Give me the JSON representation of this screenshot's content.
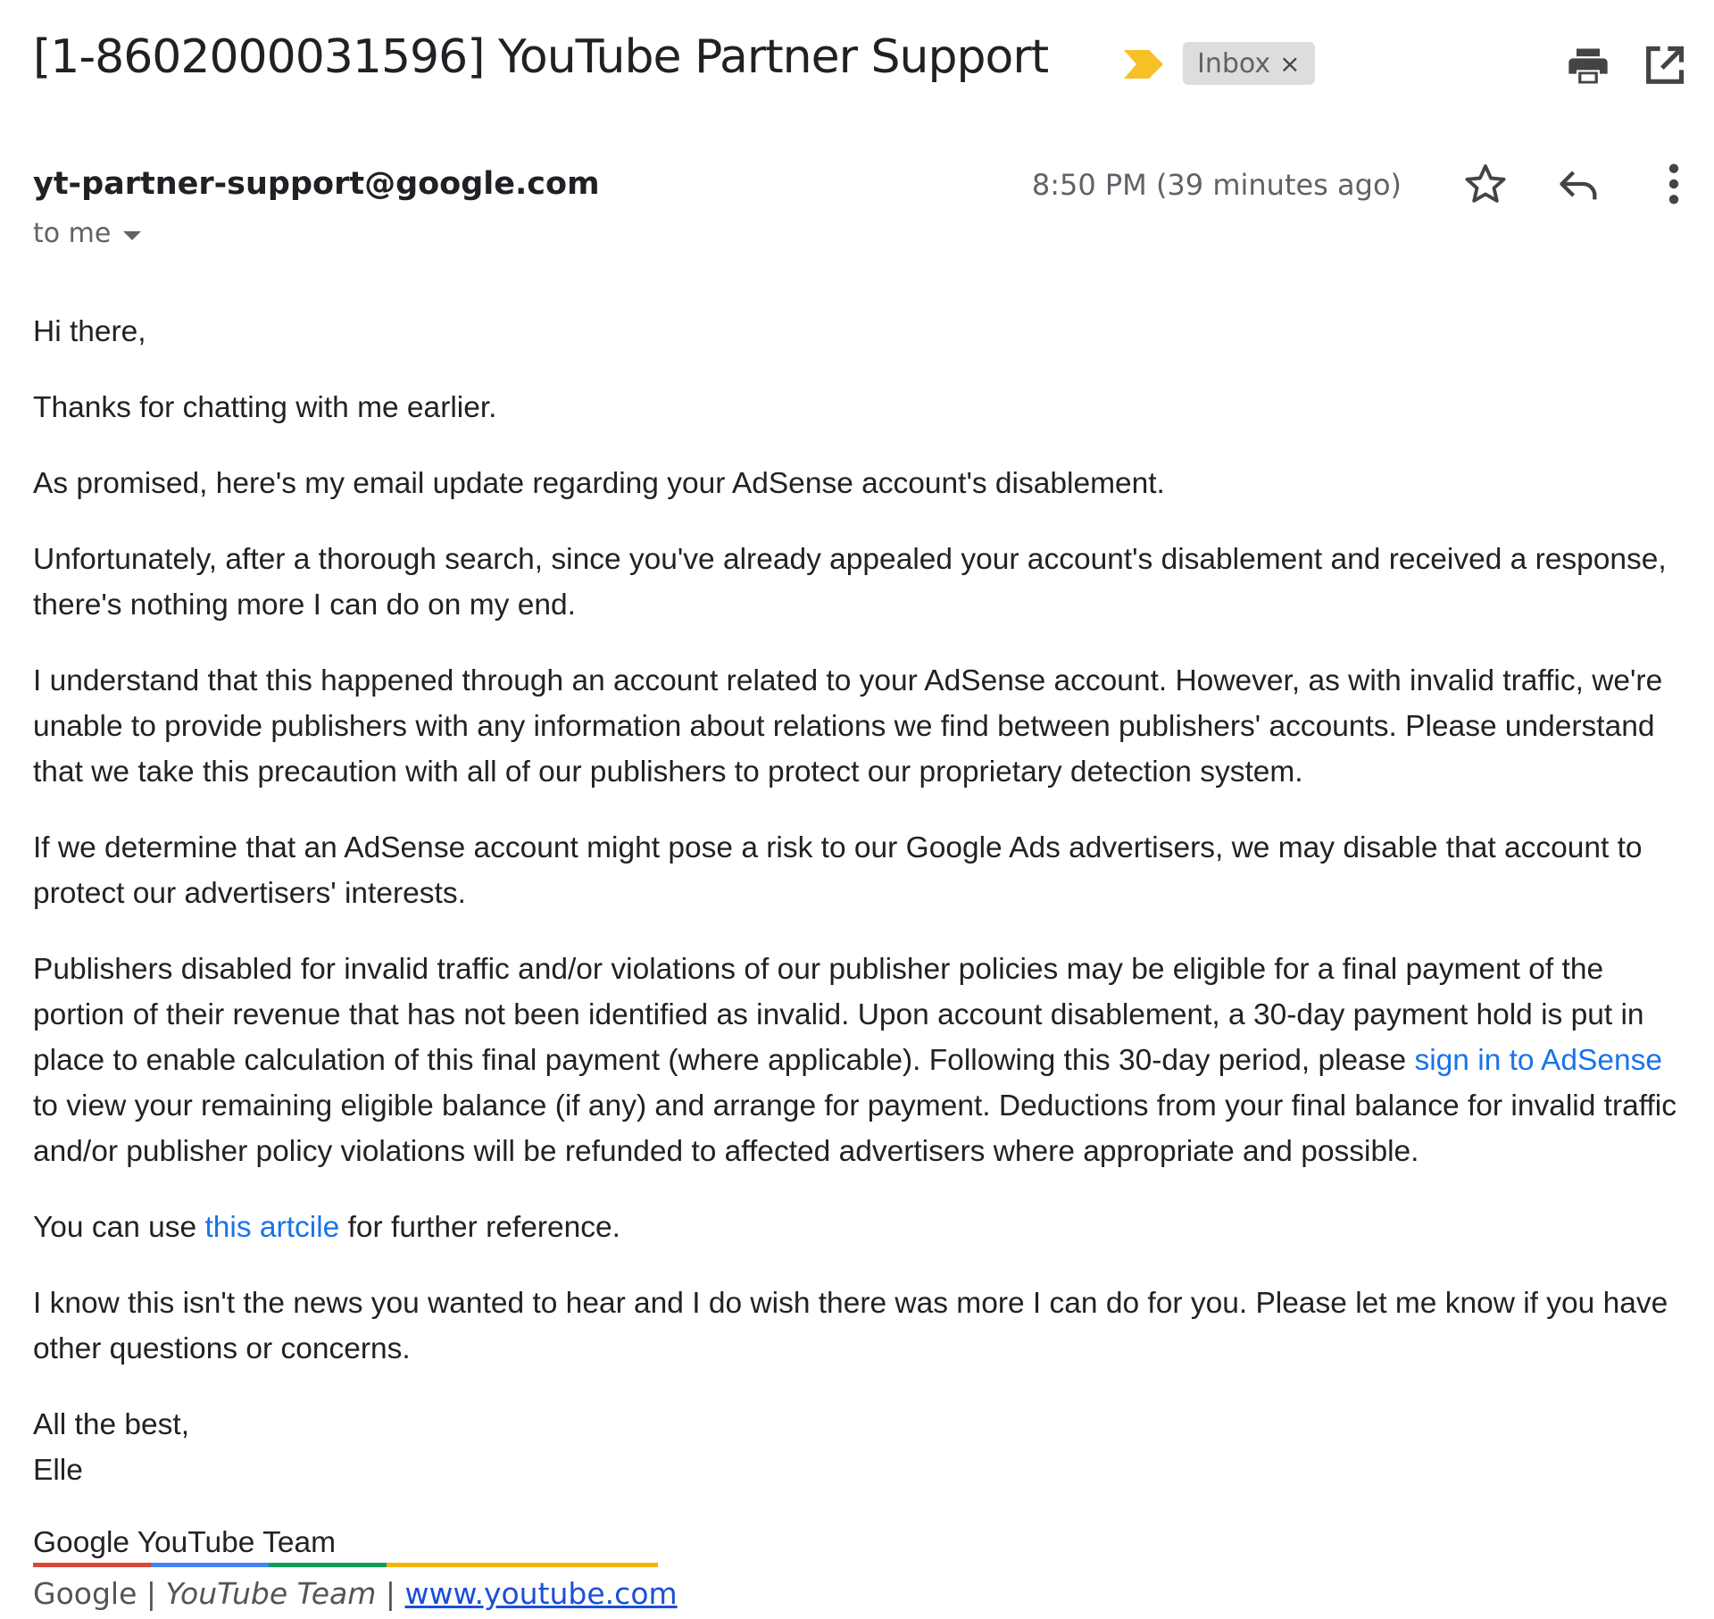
{
  "header": {
    "subject": "[1-8602000031596] YouTube Partner Support",
    "label": "Inbox",
    "label_remove": "×",
    "importance_color": "#f6c026"
  },
  "message": {
    "sender": "yt-partner-support@google.com",
    "recipient": "to me",
    "time": "8:50 PM (39 minutes ago)"
  },
  "body": {
    "greeting": "Hi there,",
    "p1": "Thanks for chatting with me earlier.",
    "p2": "As promised, here's my email update regarding your AdSense account's disablement.",
    "p3": "Unfortunately, after a thorough search, since you've already appealed your account's disablement and received a response, there's nothing more I can do on my end.",
    "p4": "I understand that this happened through an account related to your AdSense account. However, as with invalid traffic, we're unable to provide publishers with any information about relations we find between publishers' accounts. Please understand that we take this precaution with all of our publishers to protect our proprietary detection system.",
    "p5": "If we determine that an AdSense account might pose a risk to our Google Ads advertisers, we may disable that account to protect our advertisers' interests.",
    "p6_before": "Publishers disabled for invalid traffic and/or violations of our publisher policies may be eligible for a final payment of the portion of their revenue that has not been identified as invalid. Upon account disablement, a 30-day payment hold is put in place to enable calculation of this final payment (where applicable). Following this 30-day period, please ",
    "p6_link": "sign in to AdSense",
    "p6_after": " to view your remaining eligible balance (if any) and arrange for payment. Deductions from your final balance for invalid traffic and/or publisher policy violations will be refunded to affected advertisers where appropriate and possible.",
    "p7_before": "You can use ",
    "p7_link": "this artcile",
    "p7_after": " for further reference.",
    "p8": "I know this isn't the news you wanted to hear and I do wish there was more I can do for you. Please let me know if you have other questions or concerns.",
    "closing": "All the best,",
    "name": "Elle"
  },
  "signature": {
    "team": "Google YouTube Team",
    "company": "Google",
    "separator": "|",
    "team_italic": "YouTube Team",
    "website": "www.youtube.com",
    "bar_colors": [
      "#db4437",
      "#4285f4",
      "#0f9d58",
      "#f4b400"
    ]
  }
}
